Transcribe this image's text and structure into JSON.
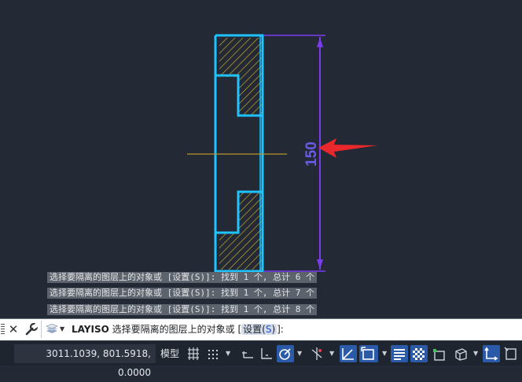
{
  "drawing": {
    "dimension_text": "150",
    "colors": {
      "background": "#232a35",
      "outline": "#1ec3ff",
      "hatch": "#c9a52a",
      "dimension": "#7b3cf0",
      "dimension_text": "#6a5ce8",
      "arrow_marker": "#e8282c",
      "centerline": "#b8962a"
    }
  },
  "history": [
    "选择要隔离的图层上的对象或 [设置(S)]: 找到 1 个, 总计 6 个",
    "选择要隔离的图层上的对象或 [设置(S)]: 找到 1 个, 总计 7 个",
    "选择要隔离的图层上的对象或 [设置(S)]: 找到 1 个, 总计 8 个"
  ],
  "command_line": {
    "command": "LAYISO",
    "prompt": "选择要隔离的图层上的对象或",
    "open_bracket": "[",
    "option_label": "设置(",
    "option_hotkey": "S",
    "option_close": ")",
    "close_bracket": "]:",
    "close_icon": "close-icon",
    "customize_icon": "wrench-icon",
    "recent_icon": "layer-stack-icon"
  },
  "status_bar": {
    "coordinates": "3011.1039, 801.5918, 0.0000",
    "model_label": "模型",
    "icons": [
      "grid-icon",
      "snap-icon",
      "infer-icon",
      "ortho-icon",
      "polar-icon",
      "isodraft-icon",
      "dynamic-ucs-icon",
      "lineweight-icon",
      "transparency-icon",
      "selection-cycling-icon",
      "3d-osnap-icon",
      "annotation-visibility-icon"
    ]
  }
}
